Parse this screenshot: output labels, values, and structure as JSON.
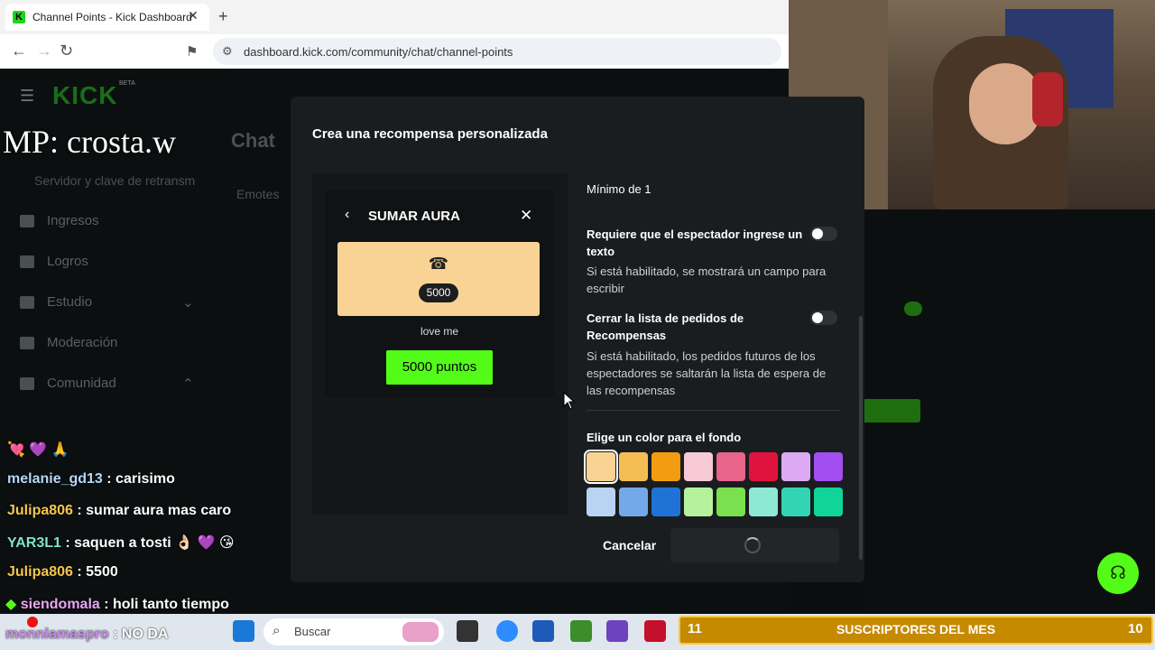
{
  "browser": {
    "tab_title": "Channel Points - Kick Dashboard",
    "url": "dashboard.kick.com/community/chat/channel-points",
    "new_tab_label": "+"
  },
  "dashboard": {
    "logo": "KICK",
    "logo_badge": "BETA",
    "chat_heading": "Chat",
    "emotes_tab": "Emotes",
    "server_key": "Servidor y clave de retransm",
    "sidebar": [
      {
        "label": "Ingresos"
      },
      {
        "label": "Logros"
      },
      {
        "label": "Estudio"
      },
      {
        "label": "Moderación"
      },
      {
        "label": "Comunidad"
      }
    ]
  },
  "overlay": {
    "mp_text": "MP: crosta.w"
  },
  "chat": [
    {
      "user": "melanie_gd13",
      "message": " : carisimo",
      "color": "#b6d7f7"
    },
    {
      "user": "Julipa806",
      "message": " : sumar aura mas caro",
      "color": "#f5c74c"
    },
    {
      "user": "YAR3L1",
      "message": " : saquen a tosti 👌🏻 💜 😘",
      "color": "#7fe3c9"
    },
    {
      "user": "Julipa806",
      "message": " : 5500",
      "color": "#f5c74c"
    },
    {
      "user": "siendomala",
      "message": " : holi tanto tiempo",
      "color": "#e7a7f2"
    },
    {
      "user": "monnlamaspro",
      "message": " : NO DA",
      "color": "#c58ae8"
    }
  ],
  "modal": {
    "title": "Crea una recompensa personalizada",
    "preview": {
      "title": "SUMAR AURA",
      "cost": "5000",
      "description": "love me",
      "points_button": "5000 puntos"
    },
    "form": {
      "min_label": "Mínimo de 1",
      "require_text_title": "Requiere que el espectador ingrese un texto",
      "require_text_desc": "Si está habilitado, se mostrará un campo para escribir",
      "close_queue_title": "Cerrar la lista de pedidos de Recompensas",
      "close_queue_desc": "Si está habilitado, los pedidos futuros de los espectadores se saltarán la lista de espera de las recompensas",
      "color_title": "Elige un color para el fondo",
      "colors": [
        "#f8d393",
        "#f5be55",
        "#f39c12",
        "#f8c9d6",
        "#e8648a",
        "#e0123e",
        "#dcaaf3",
        "#a34ef0",
        "#b8d4f2",
        "#73a9e8",
        "#1f73d6",
        "#b6f29c",
        "#7be04d",
        "#8de8d4",
        "#33d4b3",
        "#11d49a"
      ],
      "cancel_label": "Cancelar"
    }
  },
  "taskbar": {
    "search_placeholder": "Buscar"
  },
  "subs_banner": {
    "left_count": "11",
    "title": "SUSCRIPTORES DEL MES",
    "right_count": "10"
  }
}
